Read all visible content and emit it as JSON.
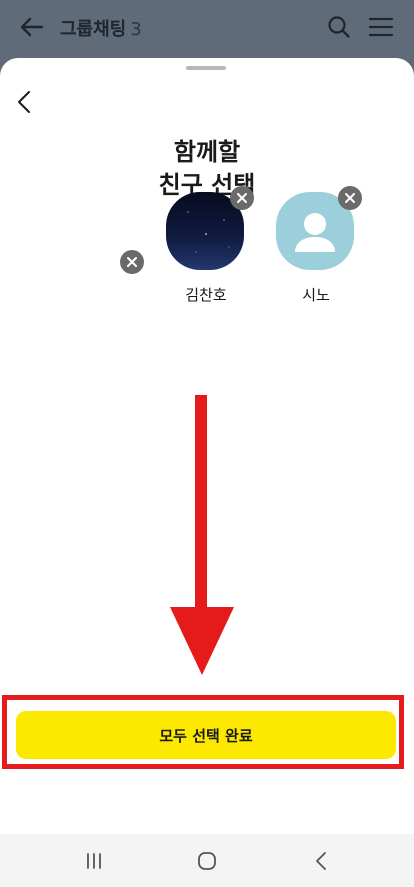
{
  "appbar": {
    "title": "그룹채팅",
    "count": "3"
  },
  "sheet": {
    "heading_line1": "함께할",
    "heading_line2": "친구 선택"
  },
  "friends": [
    {
      "name": "김찬호"
    },
    {
      "name": "시노"
    }
  ],
  "footer": {
    "confirm_label": "모두 선택 완료"
  },
  "colors": {
    "accent": "#fde800",
    "annotation": "#e51b1b",
    "avatar_default": "#9ccfdc"
  },
  "icons": [
    "back-arrow-icon",
    "search-icon",
    "hamburger-menu-icon",
    "chevron-left-icon",
    "close-icon",
    "person-icon",
    "recent-apps-icon",
    "home-icon",
    "system-back-icon"
  ]
}
